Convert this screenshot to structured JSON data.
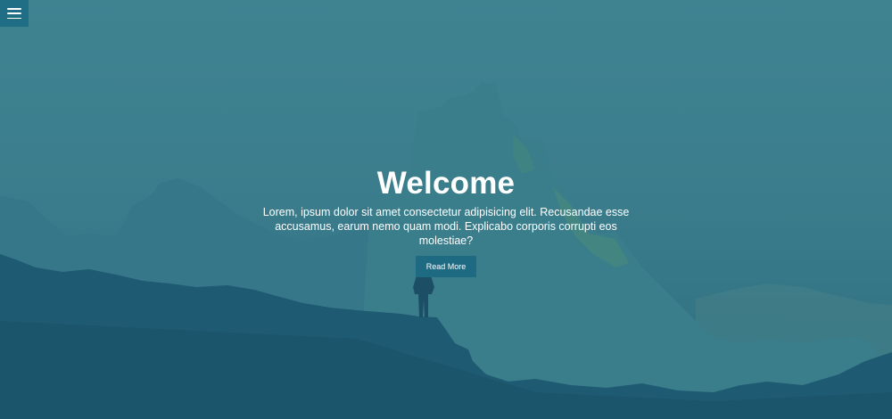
{
  "nav": {
    "menu_icon": "hamburger-menu-icon"
  },
  "hero": {
    "title": "Welcome",
    "description": "Lorem, ipsum dolor sit amet consectetur adipisicing elit. Recusandae esse accusamus, earum nemo quam modi. Explicabo corporis corrupti eos molestiae?",
    "button_label": "Read More"
  },
  "colors": {
    "overlay": "#3f8391",
    "button": "#1e6a82",
    "menu_button": "#1f6e86",
    "text": "#ffffff"
  }
}
